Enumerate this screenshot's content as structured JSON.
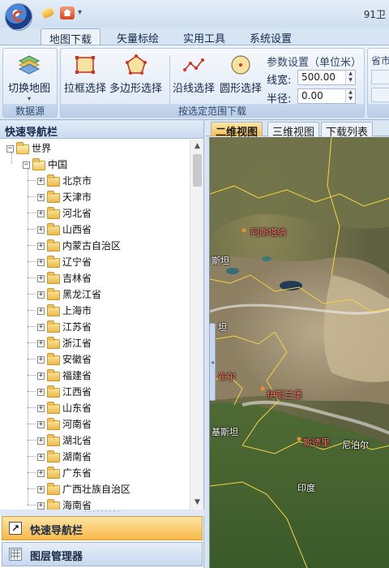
{
  "window": {
    "title": "91卫"
  },
  "ribbon_tabs": [
    "地图下载",
    "矢量标绘",
    "实用工具",
    "系统设置"
  ],
  "ribbon": {
    "switch_map": "切换地图",
    "group_datasource": "数据源",
    "rect_select": "拉框选择",
    "polygon_select": "多边形选择",
    "line_select": "沿线选择",
    "circle_select": "圆形选择",
    "param_title": "参数设置（单位米）",
    "line_width_label": "线宽:",
    "line_width_value": "500.00",
    "radius_label": "半径:",
    "radius_value": "0.00",
    "group_select_download": "按选定范围下载",
    "cut_label": "省市"
  },
  "nav": {
    "title": "快速导航栏",
    "root": "世界",
    "country": "中国",
    "provinces": [
      "北京市",
      "天津市",
      "河北省",
      "山西省",
      "内蒙古自治区",
      "辽宁省",
      "吉林省",
      "黑龙江省",
      "上海市",
      "江苏省",
      "浙江省",
      "安徽省",
      "福建省",
      "江西省",
      "山东省",
      "河南省",
      "湖北省",
      "湖南省",
      "广东省",
      "广西壮族自治区",
      "海南省"
    ],
    "bottom_nav_button": "快速导航栏",
    "bottom_layer_button": "图层管理器"
  },
  "map_tabs": [
    "二维视图",
    "三维视图",
    "下载列表"
  ],
  "map_labels": {
    "red": [
      "阿斯塔纳",
      "布尔",
      "伊斯兰堡",
      "新德里"
    ],
    "white": [
      "斯坦",
      "坦",
      "基斯坦",
      "尼泊尔",
      "印度"
    ]
  },
  "colors": {
    "accent": "#f6bf55",
    "ribbon": "#dae7f5",
    "border": "#9fb5d3"
  }
}
